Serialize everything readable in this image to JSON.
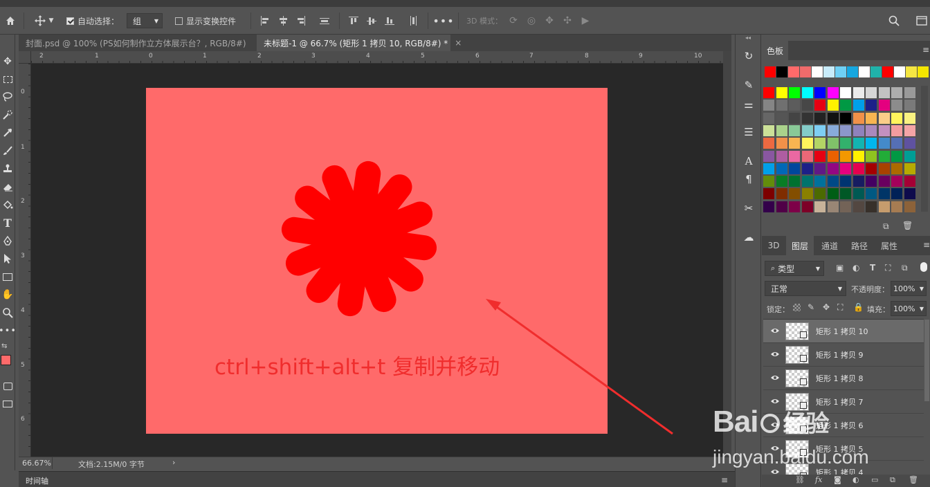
{
  "options_bar": {
    "auto_select_label": "自动选择：",
    "auto_select_target": "组",
    "show_transform_label": "显示变换控件",
    "mode_3d_label": "3D 模式："
  },
  "tabs": [
    {
      "label": "封面.psd @ 100% (PS如何制作立方体展示台？, RGB/8#)",
      "close": "×",
      "active": false
    },
    {
      "label": "未标题-1 @ 66.7% (矩形 1 拷贝 10, RGB/8#) *",
      "close": "×",
      "active": true
    }
  ],
  "ruler_top_labels": [
    "2",
    "1",
    "0",
    "1",
    "2",
    "3",
    "4",
    "5",
    "6",
    "7",
    "8",
    "9",
    "10"
  ],
  "ruler_left_labels": [
    "0",
    "1",
    "2",
    "3",
    "4",
    "5",
    "6"
  ],
  "canvas": {
    "caption": "ctrl+shift+alt+t 复制并移动",
    "artboard_color": "#ff6a6a",
    "shape_color": "#ff0000",
    "arrow_color": "#f02d2d",
    "spoke_count": 12
  },
  "status": {
    "zoom": "66.67%",
    "doc_info": "文档:2.15M/0 字节",
    "arrow": "›"
  },
  "timeline_label": "时间轴",
  "swatches_panel": {
    "tab_label": "色板",
    "recent": [
      "#ff0000",
      "#000000",
      "#ff6a6a",
      "#f06b6b",
      "#ffffff",
      "#c8ecfb",
      "#6fd0f5",
      "#17a7e0",
      "#ffffff",
      "#20b2aa",
      "#ff0000",
      "#ffffff",
      "#f5e642",
      "#f5e600"
    ],
    "rows": [
      [
        "#ff0000",
        "#ffff00",
        "#00ff00",
        "#00ffff",
        "#0000ff",
        "#ff00ff",
        "#ffffff",
        "#ebebeb",
        "#d6d6d6",
        "#c2c2c2",
        "#adadad",
        "#999999"
      ],
      [
        "#858585",
        "#707070",
        "#5c5c5c",
        "#474747",
        "#e60012",
        "#fff100",
        "#009944",
        "#00a0e9",
        "#1d2088",
        "#e4007f",
        "#8c8c8c",
        "#7a7a7a"
      ],
      [
        "#666666",
        "#555555",
        "#444444",
        "#333333",
        "#222222",
        "#111111",
        "#000000",
        "#f19149",
        "#f8b551",
        "#facd89",
        "#fff45c",
        "#f9f181"
      ],
      [
        "#cce198",
        "#aad28b",
        "#89c997",
        "#84ccc9",
        "#7ecef4",
        "#88abda",
        "#8c97cb",
        "#8f82bc",
        "#aa89bd",
        "#c490bf",
        "#f29c9f",
        "#f4a4a6"
      ],
      [
        "#ec6941",
        "#f19149",
        "#f8b551",
        "#fff45c",
        "#b3d465",
        "#80c269",
        "#32b16c",
        "#13b5b1",
        "#00b7ee",
        "#448aca",
        "#556fb5",
        "#5f52a0"
      ],
      [
        "#8957a1",
        "#ae5da1",
        "#ea68a2",
        "#eb6877",
        "#e60012",
        "#eb6100",
        "#f39800",
        "#fff100",
        "#8fc31f",
        "#22ac38",
        "#009944",
        "#009e96"
      ],
      [
        "#00a0e9",
        "#0068b7",
        "#00479d",
        "#1d2088",
        "#601986",
        "#920783",
        "#e4007f",
        "#e5004f",
        "#a40000",
        "#a84200",
        "#ac6a00",
        "#b7aa00"
      ],
      [
        "#638c0b",
        "#097c25",
        "#007130",
        "#00736d",
        "#00719c",
        "#004986",
        "#003471",
        "#171c61",
        "#440062",
        "#6a005f",
        "#a4005b",
        "#a40035"
      ],
      [
        "#7d0000",
        "#7f2d00",
        "#834e00",
        "#8a8000",
        "#4c6a01",
        "#005e15",
        "#005826",
        "#005953",
        "#005982",
        "#003567",
        "#002157",
        "#0e0b4c"
      ],
      [
        "#33004a",
        "#500047",
        "#7d0048",
        "#7d0027",
        "#c7b299",
        "#998675",
        "#736357",
        "#534741",
        "#37302a",
        "#c69c6d",
        "#a67c52",
        "#8c6239"
      ]
    ]
  },
  "layers_panel": {
    "tabs": [
      "3D",
      "图层",
      "通道",
      "路径",
      "属性"
    ],
    "filter_label": "类型",
    "blend_mode": "正常",
    "opacity_label": "不透明度：",
    "opacity_value": "100%",
    "lock_label": "锁定：",
    "fill_label": "填充：",
    "fill_value": "100%",
    "layers": [
      {
        "name": "矩形 1 拷贝 10",
        "selected": true
      },
      {
        "name": "矩形 1 拷贝 9",
        "selected": false
      },
      {
        "name": "矩形 1 拷贝 8",
        "selected": false
      },
      {
        "name": "矩形 1 拷贝 7",
        "selected": false
      },
      {
        "name": "矩形 1 拷贝 6",
        "selected": false
      },
      {
        "name": "矩形 1 拷贝 5",
        "selected": false
      },
      {
        "name": "矩形 1 拷贝 4",
        "selected": false
      }
    ]
  },
  "watermark": {
    "brand": "Bai",
    "brand_cn": "经验",
    "url": "jingyan.baidu.com"
  },
  "colors": {
    "foreground": "#ff6a6a",
    "background": "#ffffff"
  }
}
